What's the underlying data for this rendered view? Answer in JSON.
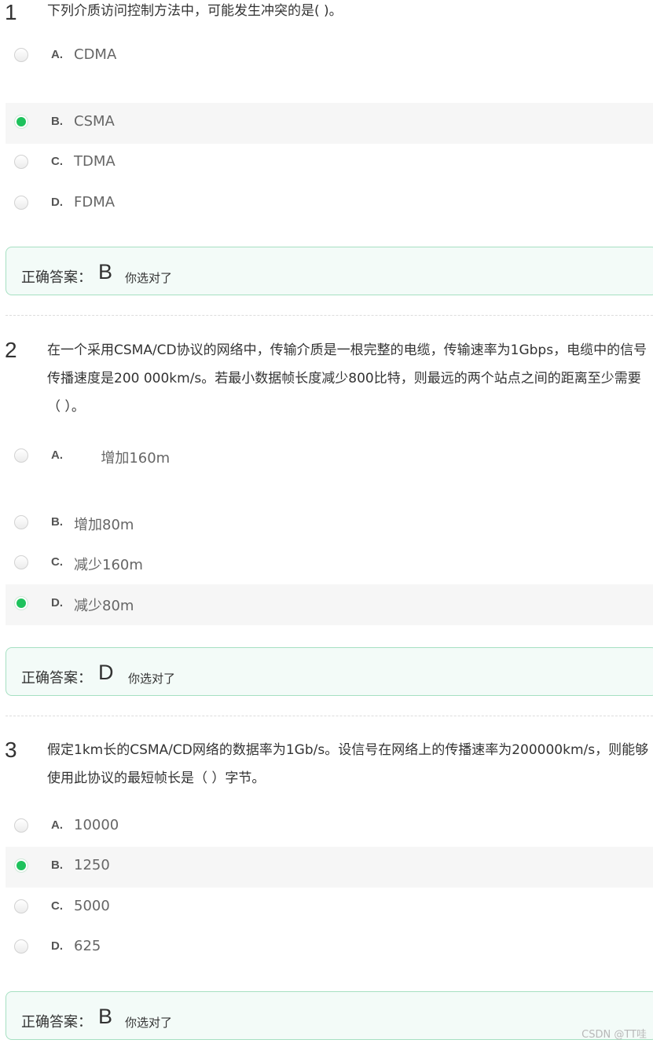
{
  "questions": [
    {
      "number": "1",
      "text": "下列介质访问控制方法中，可能发生冲突的是(      )。",
      "options": [
        {
          "letter": "A.",
          "text": "CDMA",
          "selected": false
        },
        {
          "letter": "B.",
          "text": "CSMA",
          "selected": true
        },
        {
          "letter": "C.",
          "text": "TDMA",
          "selected": false
        },
        {
          "letter": "D.",
          "text": "FDMA",
          "selected": false
        }
      ],
      "answer": {
        "label": "正确答案：",
        "letter": "B",
        "status": "你选对了"
      }
    },
    {
      "number": "2",
      "text": "在一个采用CSMA/CD协议的网络中，传输介质是一根完整的电缆，传输速率为1Gbps，电缆中的信号传播速度是200 000km/s。若最小数据帧长度减少800比特，则最远的两个站点之间的距离至少需要（    ）。",
      "options": [
        {
          "letter": "A.",
          "text": "      增加160m",
          "selected": false
        },
        {
          "letter": "B.",
          "text": "增加80m",
          "selected": false
        },
        {
          "letter": "C.",
          "text": "减少160m",
          "selected": false
        },
        {
          "letter": "D.",
          "text": "减少80m",
          "selected": true
        }
      ],
      "answer": {
        "label": "正确答案：",
        "letter": "D",
        "status": "你选对了"
      }
    },
    {
      "number": "3",
      "text": "假定1km长的CSMA/CD网络的数据率为1Gb/s。设信号在网络上的传播速率为200000km/s，则能够使用此协议的最短帧长是（      ）字节。",
      "options": [
        {
          "letter": "A.",
          "text": "10000",
          "selected": false
        },
        {
          "letter": "B.",
          "text": "1250",
          "selected": true
        },
        {
          "letter": "C.",
          "text": "5000",
          "selected": false
        },
        {
          "letter": "D.",
          "text": "625",
          "selected": false
        }
      ],
      "answer": {
        "label": "正确答案：",
        "letter": "B",
        "status": "你选对了"
      }
    }
  ],
  "watermark": "CSDN @TT哇",
  "colors": {
    "selected_radio": "#1ec25c",
    "answer_border": "#a6e0c2",
    "answer_background": "#f3fbf8",
    "selected_row": "#f6f6f6"
  }
}
